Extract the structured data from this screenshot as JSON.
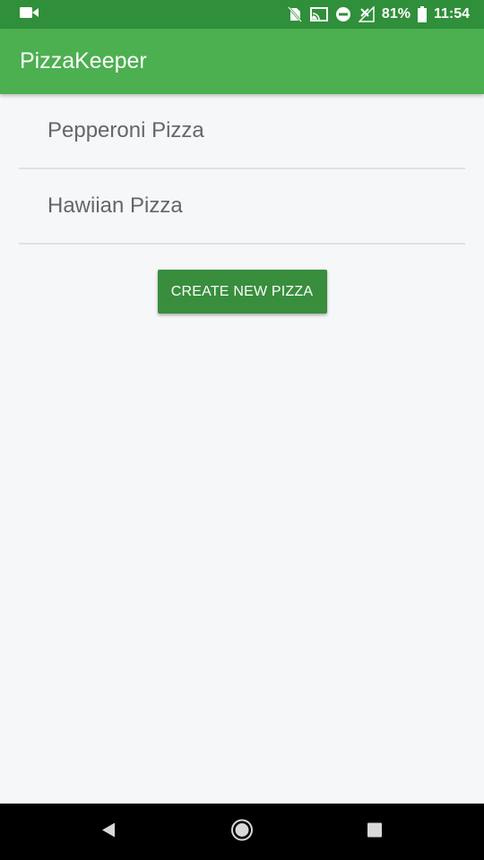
{
  "status_bar": {
    "battery": "81%",
    "time": "11:54",
    "icons": [
      "video-camera-icon",
      "no-sim-icon",
      "cast-icon",
      "do-not-disturb-icon",
      "no-signal-icon",
      "battery-icon"
    ]
  },
  "app_bar": {
    "title": "PizzaKeeper"
  },
  "pizzas": [
    {
      "name": "Pepperoni Pizza"
    },
    {
      "name": "Hawiian Pizza"
    }
  ],
  "create_button": {
    "label": "CREATE NEW PIZZA"
  },
  "nav_bar": {
    "icons": [
      "back-icon",
      "home-icon",
      "recents-icon"
    ]
  },
  "colors": {
    "status_bar": "#2f8f3a",
    "app_bar": "#4caf50",
    "button": "#388e3c",
    "background": "#f6f7f9",
    "list_text": "#666666",
    "divider": "#dfe1e4"
  }
}
